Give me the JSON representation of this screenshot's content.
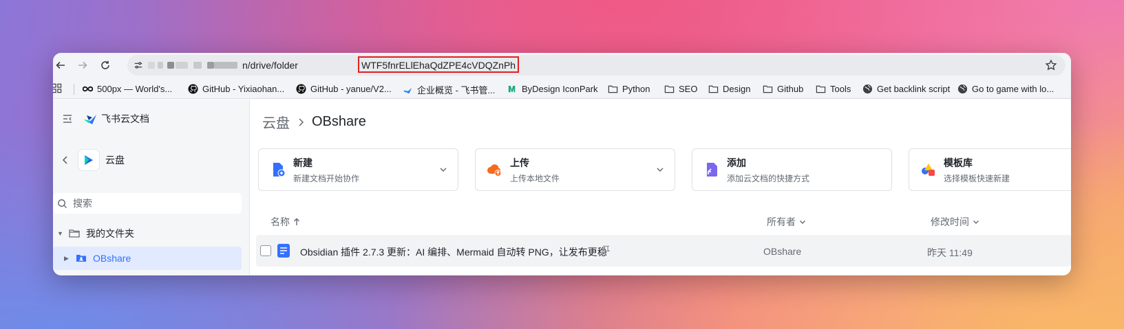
{
  "browser": {
    "url_prefix": "n/drive/folder",
    "url_highlight": "WTF5fnrELlEhaQdZPE4cVDQZnPh"
  },
  "bookmarks": [
    {
      "label": "500px — World's...",
      "icon": "infinity-icon"
    },
    {
      "label": "GitHub - Yixiaohan...",
      "icon": "github-icon"
    },
    {
      "label": "GitHub - yanue/V2...",
      "icon": "github-icon"
    },
    {
      "label": "企业概览 - 飞书管...",
      "icon": "feishu-icon"
    },
    {
      "label": "ByDesign IconPark",
      "icon": "iconpark-icon"
    },
    {
      "label": "Python",
      "icon": "folder-icon"
    },
    {
      "label": "SEO",
      "icon": "folder-icon"
    },
    {
      "label": "Design",
      "icon": "folder-icon"
    },
    {
      "label": "Github",
      "icon": "folder-icon"
    },
    {
      "label": "Tools",
      "icon": "folder-icon"
    },
    {
      "label": "Get backlink script",
      "icon": "globe-icon"
    },
    {
      "label": "Go to game with lo...",
      "icon": "globe-icon"
    }
  ],
  "sidebar": {
    "brand": "飞书云文档",
    "space": "云盘",
    "search_placeholder": "搜索",
    "tree": [
      {
        "label": "我的文件夹"
      },
      {
        "label": "OBshare"
      }
    ]
  },
  "main": {
    "breadcrumb": {
      "root": "云盘",
      "current": "OBshare"
    },
    "cards": [
      {
        "title": "新建",
        "desc": "新建文档开始协作"
      },
      {
        "title": "上传",
        "desc": "上传本地文件"
      },
      {
        "title": "添加",
        "desc": "添加云文档的快捷方式"
      },
      {
        "title": "模板库",
        "desc": "选择模板快速新建"
      }
    ],
    "columns": {
      "name": "名称",
      "owner": "所有者",
      "modified": "修改时间"
    },
    "files": [
      {
        "name": "Obsidian 插件 2.7.3 更新：AI 编排、Mermaid 自动转 PNG，让发布更稳",
        "owner": "OBshare",
        "modified": "昨天 11:49"
      }
    ]
  },
  "colors": {
    "accent": "#3370ff",
    "highlight_border": "#e02020"
  }
}
